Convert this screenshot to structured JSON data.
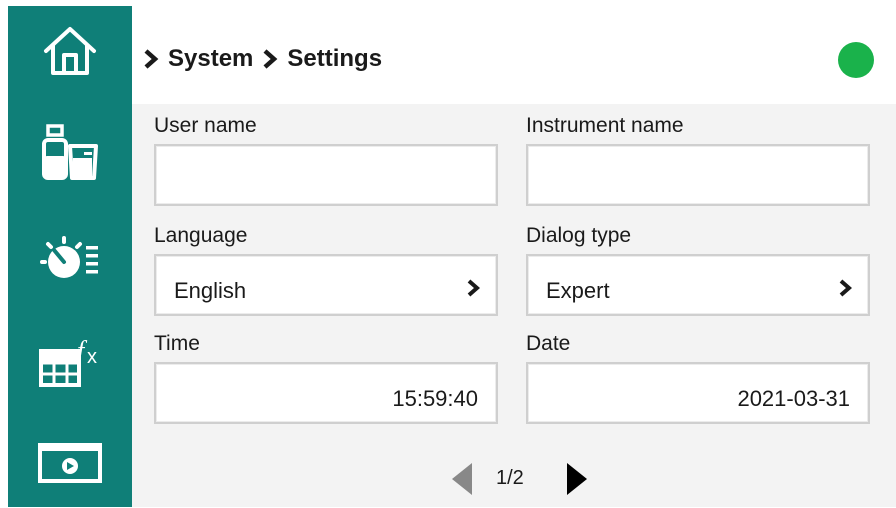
{
  "colors": {
    "sidebar": "#0f7f78",
    "status_ok": "#1ab24b",
    "content_bg": "#f3f3f3"
  },
  "sidebar": {
    "items": [
      {
        "icon": "home-icon"
      },
      {
        "icon": "sample-bottles-icon"
      },
      {
        "icon": "process-timer-icon"
      },
      {
        "icon": "table-formula-icon"
      },
      {
        "icon": "video-screen-icon"
      }
    ]
  },
  "breadcrumb": {
    "items": [
      "System",
      "Settings"
    ]
  },
  "status": {
    "icon": "status-ok-indicator"
  },
  "form": {
    "user_name_label": "User name",
    "user_name_value": "",
    "instrument_name_label": "Instrument name",
    "instrument_name_value": "",
    "language_label": "Language",
    "language_value": "English",
    "dialog_type_label": "Dialog type",
    "dialog_type_value": "Expert",
    "time_label": "Time",
    "time_value": "15:59:40",
    "date_label": "Date",
    "date_value": "2021-03-31"
  },
  "pager": {
    "text": "1/2",
    "prev_enabled": false,
    "next_enabled": true
  }
}
